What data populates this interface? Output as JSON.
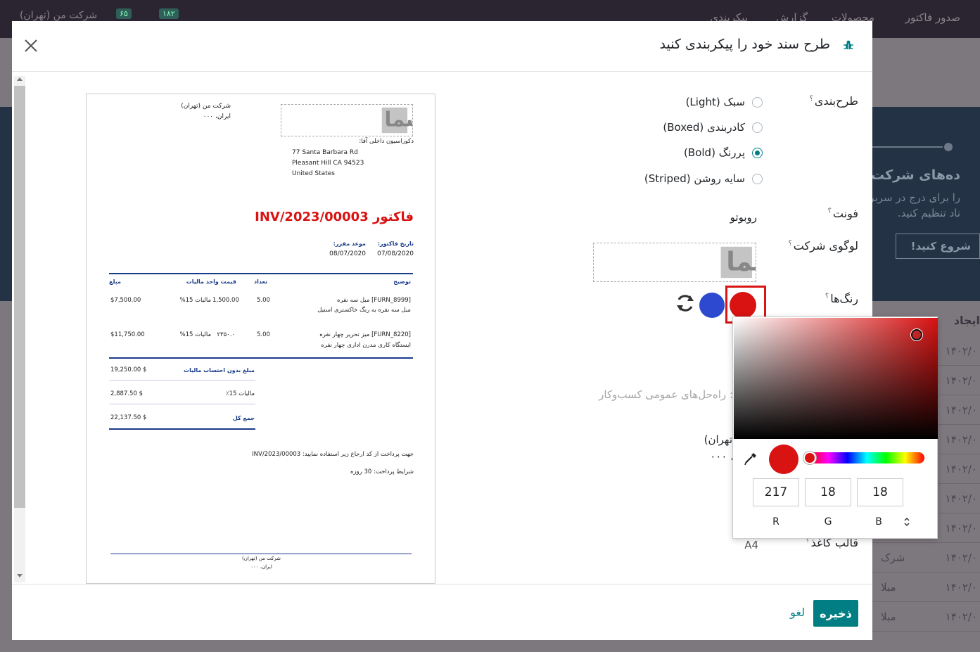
{
  "background": {
    "topnav": [
      "صدور فاکتور",
      "محصولات",
      "گزارش",
      "پیکربندی"
    ],
    "company": "شرکت من (تهران)",
    "badge_a": "۱۸۲",
    "badge_b": "۶۵",
    "banner_title": "ده‌های شرکت",
    "banner_line1": "را برای درج در سربرگ و",
    "banner_line2": "ناد تنظیم کنید.",
    "banner_button": "شروع کنید!",
    "col_header": "ایجاد",
    "rows": [
      "۱۴۰۲/۰",
      "۱۴۰۲/۰",
      "۱۴۰۲/۰",
      "۱۴۰۲/۰",
      "۱۴۰۲/۰",
      "۱۴۰۲/۰",
      "۱۴۰۲/۰",
      "۱۴۰۲/۰",
      "۱۴۰۲/۰",
      "۱۴۰۲/۰"
    ],
    "row_prefix": [
      "شرک",
      "مبلا",
      "مبلا"
    ]
  },
  "modal": {
    "title": "طرح سند خود را پیکربندی کنید",
    "save_label": "ذخیره",
    "cancel_label": "لغو"
  },
  "invoice": {
    "company_name": "شرکت من (تهران)",
    "company_country": "ایران، ۰۰۰",
    "logo_text": "لوگوشما",
    "customer_label": "دکوراسیون داخلی آقا:",
    "addr1": "77 Santa Barbara Rd",
    "addr2": "Pleasant Hill CA 94523",
    "addr3": "United States",
    "title": "فاکتور INV/2023/00003",
    "date_label": "تاریخ فاکتور:",
    "due_label": "موعد مقرر:",
    "date": "07/08/2020",
    "due": "08/07/2020",
    "headers": {
      "desc": "توضیح",
      "qty": "تعداد",
      "price_tax": "قیمت واحد  مالیات",
      "amount": "مبلغ"
    },
    "lines": [
      {
        "desc1": "[FURN_8999] مبل سه نفره",
        "desc2": "مبل سه نفره به رنگ خاکستری استیل",
        "qty": "5.00",
        "price": "1,500.00",
        "tax": "مالیات 15%",
        "amount": "$7,500.00"
      },
      {
        "desc1": "[FURN_8220] میز تحریر چهار نفره",
        "desc2": "ایستگاه کاری مدرن اداری چهار نفره",
        "qty": "5.00",
        "price": "۲۳۵۰.۰",
        "tax": "مالیات 15%",
        "amount": "$11,750.00"
      }
    ],
    "untaxed_label": "مبلغ بدون احتساب مالیات",
    "untaxed": "19,250.00 $",
    "tax_label": "مالیات 15٪",
    "tax": "2,887.50 $",
    "total_label": "جمع کل",
    "total": "22,137.50 $",
    "payment_line": "جهت پرداخت از کد ارجاع زیر استفاده نمایید: INV/2023/00003",
    "terms_line": "شرایط پرداخت: 30 روزه",
    "footer_company": "شرکت من (تهران)",
    "footer_country": "ایران، ۰۰۰"
  },
  "form": {
    "layout_label": "طرح‌بندی",
    "layout_options": [
      {
        "label": "سبک (Light)",
        "selected": false
      },
      {
        "label": "کادربندی (Boxed)",
        "selected": false
      },
      {
        "label": "پررنگ (Bold)",
        "selected": true
      },
      {
        "label": "سایه روشن (Striped)",
        "selected": false
      }
    ],
    "font_label": "فونت",
    "font_value": "روبوتو",
    "logo_label": "لوگوی شرکت",
    "logo_text": "لوگوشما",
    "colors_label": "رنگ‌ها",
    "primary_color": "#d91212",
    "secondary_color": "#2d49d0",
    "tagline_faded": ": راه‌حل‌های عمومی کسب‌وکار",
    "address_company": "ت من (تهران)",
    "address_country": "، ۰۰۰",
    "paper_label": "قالب کاغذ",
    "paper_value": "A4",
    "help_mark": "؟"
  },
  "picker": {
    "r": "217",
    "g": "18",
    "b": "18",
    "r_label": "R",
    "g_label": "G",
    "b_label": "B"
  }
}
